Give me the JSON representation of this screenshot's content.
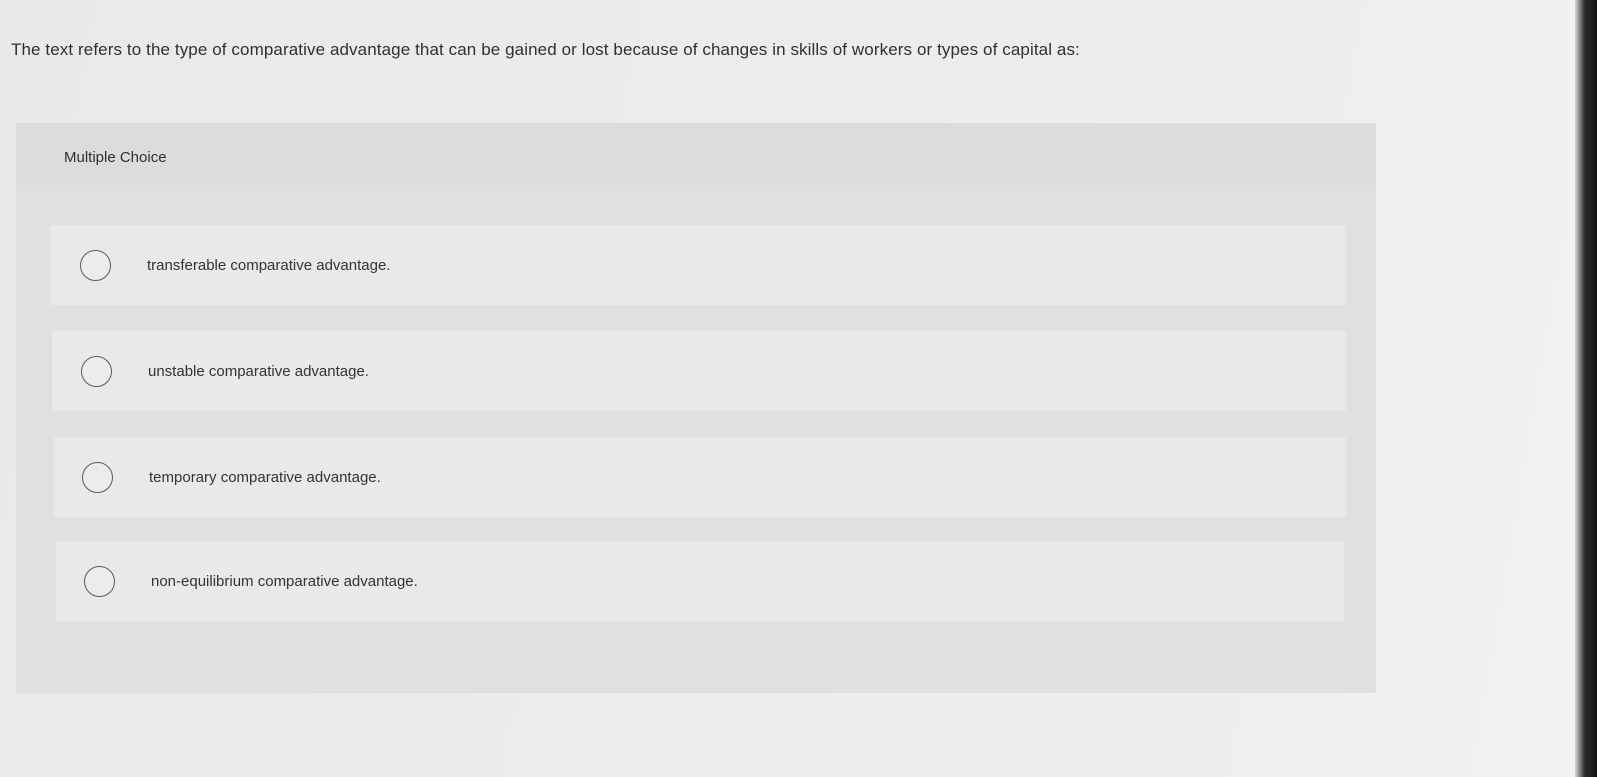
{
  "question": {
    "text": "The text refers to the type of comparative advantage that can be gained or lost because of changes in skills of workers or types of capital as:"
  },
  "multiple_choice": {
    "header": "Multiple Choice",
    "options": [
      {
        "label": "transferable comparative advantage.",
        "selected": false
      },
      {
        "label": "unstable comparative advantage.",
        "selected": false
      },
      {
        "label": "temporary comparative advantage.",
        "selected": false
      },
      {
        "label": "non-equilibrium comparative advantage.",
        "selected": false
      }
    ]
  }
}
